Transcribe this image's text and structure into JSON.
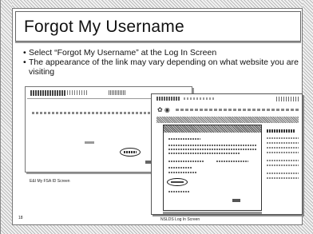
{
  "slide": {
    "title": "Forgot My Username",
    "bullets": [
      "Select “Forgot My Username” at the Log In Screen",
      "The appearance of the link may vary depending on what website you are visiting"
    ],
    "bullet_marker": "•",
    "captions": {
      "left_screenshot": "E&I My FSA ID Screen",
      "right_screenshot": "NSLDS Log In Screen"
    },
    "page_number": "18"
  }
}
